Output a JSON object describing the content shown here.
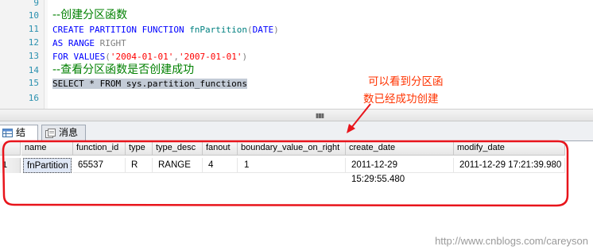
{
  "editor": {
    "line_numbers": [
      "9",
      "10",
      "11",
      "12",
      "13",
      "14",
      "15",
      "16"
    ],
    "lines": {
      "l10": "--创建分区函数",
      "l11": {
        "kw1": "CREATE PARTITION FUNCTION ",
        "name": "fnPartition",
        "paren": "(",
        "type": "DATE",
        "close": ")"
      },
      "l12": {
        "kw": "AS RANGE ",
        "dir": "RIGHT"
      },
      "l13": {
        "kw": "FOR VALUES",
        "open": "(",
        "v1": "'2004-01-01'",
        "comma": ",",
        "v2": "'2007-01-01'",
        "close": ")"
      },
      "l14": "--查看分区函数是否创建成功",
      "l15": "SELECT * FROM sys.partition_functions"
    }
  },
  "tabs": {
    "results_label": "结果",
    "messages_label": "消息"
  },
  "grid": {
    "columns": [
      "name",
      "function_id",
      "type",
      "type_desc",
      "fanout",
      "boundary_value_on_right",
      "create_date",
      "modify_date"
    ],
    "rows": [
      {
        "row_number": "1",
        "cells": [
          "fnPartition",
          "65537",
          "R",
          "RANGE",
          "4",
          "1",
          "2011-12-29 15:29:55.480",
          "2011-12-29 17:21:39.980"
        ]
      }
    ]
  },
  "annotation": {
    "line1": "可以看到分区函",
    "line2": "数已经成功创建",
    "color": "#ff3300"
  },
  "watermark": "http://www.cnblogs.com/careyson",
  "colors": {
    "keyword": "#0000ff",
    "function": "#ff00ff",
    "string": "#ff0000",
    "comment": "#008000",
    "selection": "#c3cbd6",
    "line_number": "#2b91af"
  }
}
